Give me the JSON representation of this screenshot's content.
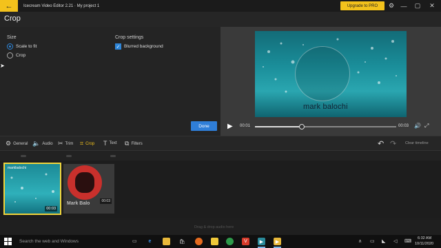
{
  "titlebar": {
    "app_title": "Icecream Video Editor 2.21  ·  My project 1",
    "back_icon": "←",
    "upgrade_label": "Upgrade to PRO",
    "settings_icon": "⚙",
    "minimize_icon": "—",
    "maximize_icon": "▢",
    "close_icon": "✕"
  },
  "header": {
    "title": "Crop"
  },
  "settings": {
    "size_label": "Size",
    "options": [
      {
        "label": "Scale to fit",
        "selected": true
      },
      {
        "label": "Crop",
        "selected": false
      }
    ],
    "crop_settings_label": "Crop settings",
    "blurred_background": {
      "label": "Blurred background",
      "checked": true,
      "check_glyph": "✓"
    },
    "done_label": "Done"
  },
  "preview": {
    "watermark_text": "mark balochi",
    "current_time": "00:01",
    "end_time": "00:03",
    "progress": 0.33,
    "play_icon": "▶",
    "volume_icon": "🔊",
    "fullscreen_icon": "⤢"
  },
  "toolbar": {
    "tools": [
      {
        "name": "general",
        "label": "General",
        "icon": "⚙",
        "active": false
      },
      {
        "name": "audio",
        "label": "Audio",
        "icon": "🔈",
        "active": false
      },
      {
        "name": "trim",
        "label": "Trim",
        "icon": "✂",
        "active": false
      },
      {
        "name": "crop",
        "label": "Crop",
        "icon": "⌗",
        "active": true
      },
      {
        "name": "text",
        "label": "Text",
        "icon": "T",
        "active": false
      },
      {
        "name": "filters",
        "label": "Filters",
        "icon": "⧉",
        "active": false
      }
    ],
    "undo_icon": "↶",
    "redo_icon": "↷",
    "clear_label": "Clear timeline"
  },
  "timeline": {
    "clips": [
      {
        "label": "markbalochi",
        "duration": "00:03"
      },
      {
        "label": "Mark Balo",
        "duration": "00:03"
      }
    ],
    "audio_hint": "Drag & drop audio here"
  },
  "taskbar": {
    "search_placeholder": "Search the web and Windows",
    "time": "6:32 AM",
    "date": "10/11/2020"
  },
  "colors": {
    "accent": "#f3c21c",
    "primary_blue": "#2f7ed8",
    "selection_border": "#f3d53a"
  }
}
